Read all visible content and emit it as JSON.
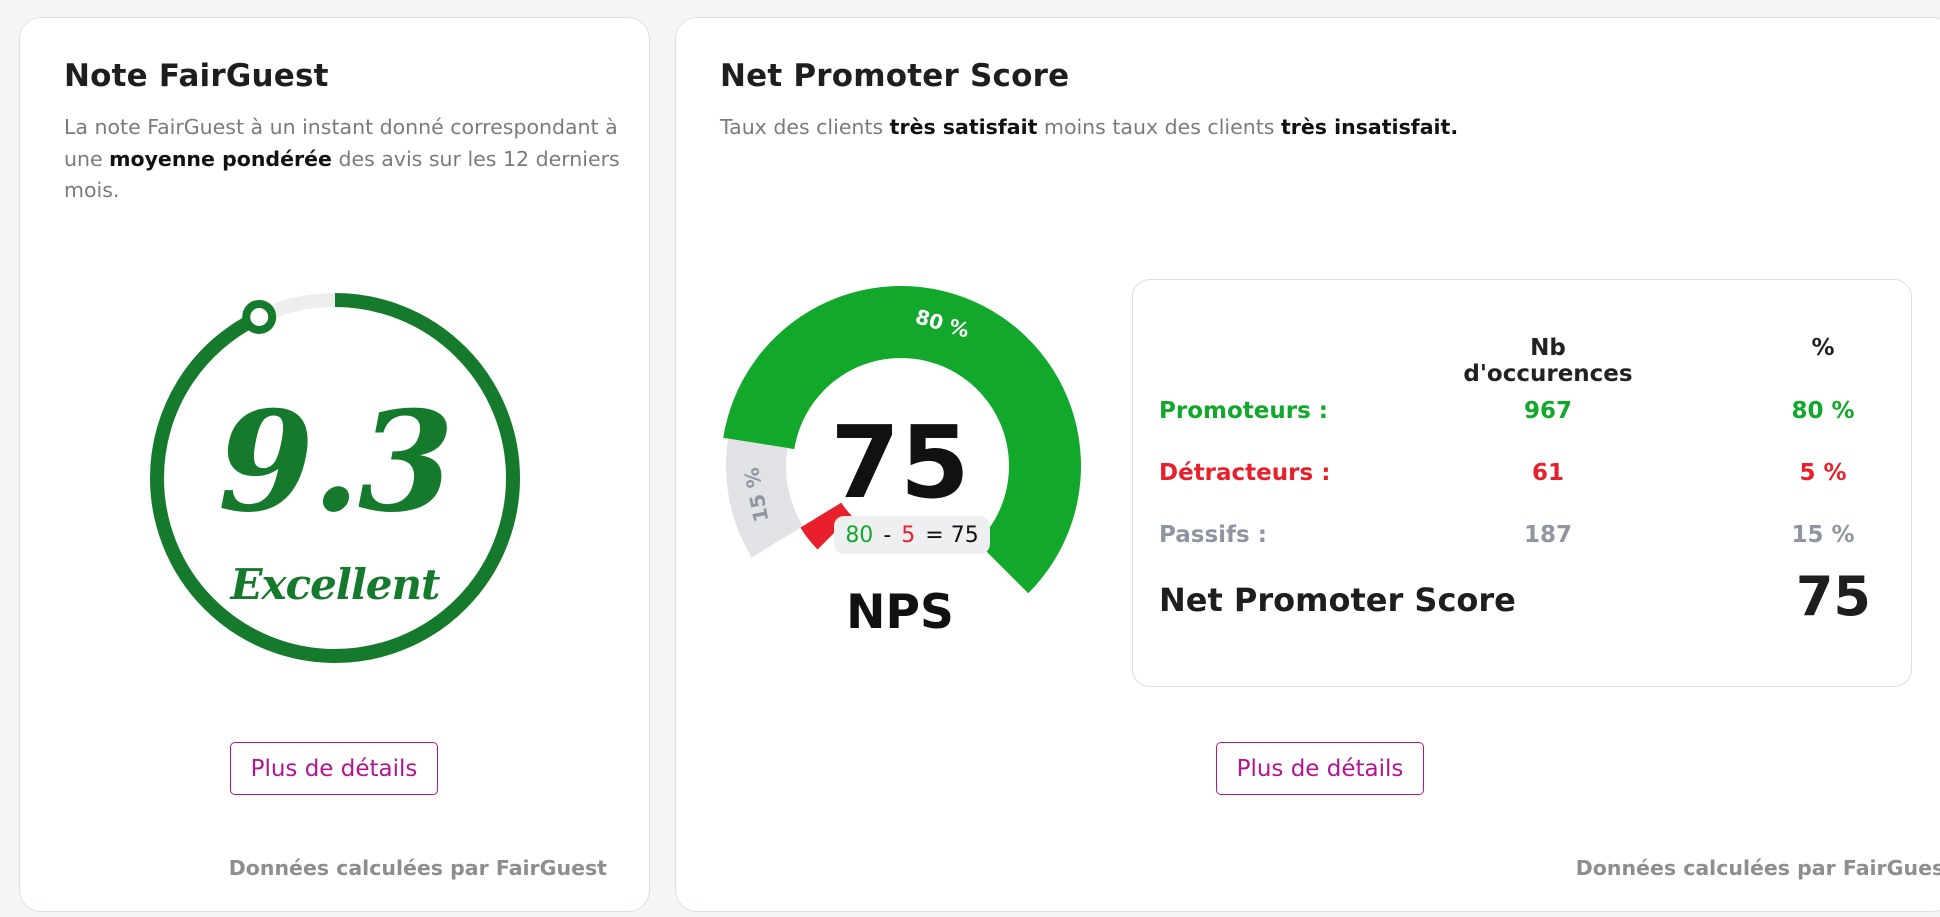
{
  "rating_card": {
    "title": "Note FairGuest",
    "desc_part1": "La note FairGuest à un instant donné correspondant à une ",
    "desc_bold": "moyenne pondérée",
    "desc_part2": " des avis sur les 12 derniers mois.",
    "score": "9.3",
    "score_label": "Excellent",
    "score_fraction": 0.93,
    "details_button": "Plus de détails",
    "footer": "Données calculées par FairGuest"
  },
  "nps_card": {
    "title": "Net Promoter Score",
    "desc_part1": "Taux des clients ",
    "desc_bold1": "très satisfait",
    "desc_part2": " moins taux des clients ",
    "desc_bold2": "très insatisfait.",
    "gauge": {
      "score": "75",
      "formula_promoters": "80",
      "formula_minus": "-",
      "formula_detractors": "5",
      "formula_result": "= 75",
      "label": "NPS",
      "promoters_pct_label": "80 %",
      "passives_pct_label": "15 %",
      "promoters_fraction": 0.8,
      "passives_fraction": 0.15,
      "detractors_fraction": 0.05
    },
    "table": {
      "col_count": "Nb d'occurences",
      "col_pct": "%",
      "rows": [
        {
          "label": "Promoteurs :",
          "count": "967",
          "pct": "80 %"
        },
        {
          "label": "Détracteurs :",
          "count": "61",
          "pct": "5 %"
        },
        {
          "label": "Passifs :",
          "count": "187",
          "pct": "15 %"
        }
      ],
      "total_label": "Net Promoter Score",
      "total_value": "75"
    },
    "details_button": "Plus de détails",
    "footer": "Données calculées par FairGuest"
  },
  "colors": {
    "rating_green": "#157a2c",
    "promoters_green": "#12a82b",
    "detractors_red": "#e8202c",
    "passives_grey": "#e1e2e6",
    "button_magenta": "#b3148f"
  }
}
